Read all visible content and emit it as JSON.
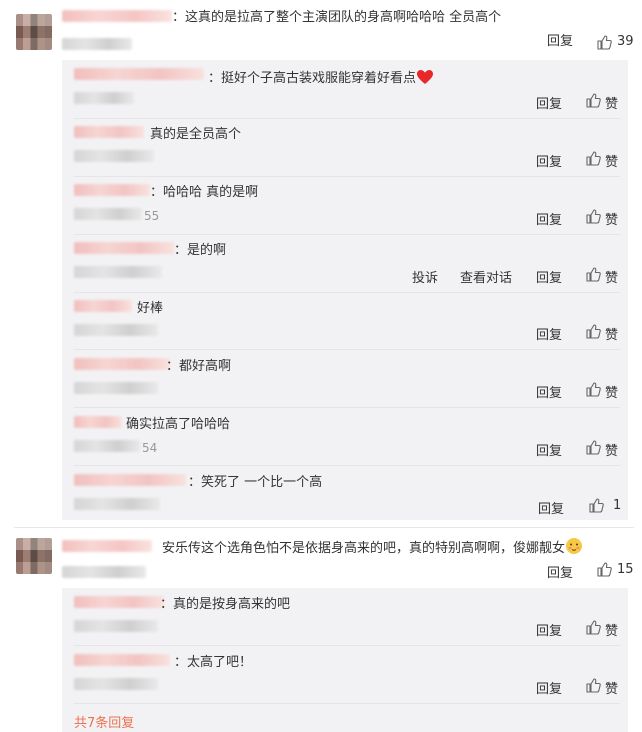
{
  "comments": [
    {
      "text": "：这真的是拉高了整个主演团队的身高啊哈哈哈 全员高个",
      "reply": "回复",
      "likes": "39",
      "replies": [
        {
          "text": "：挺好个子高古装戏服能穿着好看点",
          "reply": "回复",
          "like": "赞"
        },
        {
          "text": "真的是全员高个",
          "reply": "回复",
          "like": "赞"
        },
        {
          "text": "：哈哈哈 真的是啊",
          "suffix": "55",
          "reply": "回复",
          "like": "赞"
        },
        {
          "text": "：是的啊",
          "report": "投诉",
          "view": "查看对话",
          "reply": "回复",
          "like": "赞"
        },
        {
          "text": "好棒",
          "reply": "回复",
          "like": "赞"
        },
        {
          "text": "：都好高啊",
          "reply": "回复",
          "like": "赞"
        },
        {
          "text": "确实拉高了哈哈哈",
          "suffix": "54",
          "reply": "回复",
          "like": "赞"
        },
        {
          "text": "：笑死了 一个比一个高",
          "reply": "回复",
          "like": "1"
        }
      ]
    },
    {
      "text": "安乐传这个选角色怕不是依据身高来的吧，真的特别高啊啊，俊娜靓女",
      "reply": "回复",
      "likes": "15",
      "replies": [
        {
          "text": "：真的是按身高来的吧",
          "reply": "回复",
          "like": "赞"
        },
        {
          "text": "：太高了吧！",
          "reply": "回复",
          "like": "赞"
        }
      ],
      "more": "共7条回复"
    }
  ]
}
